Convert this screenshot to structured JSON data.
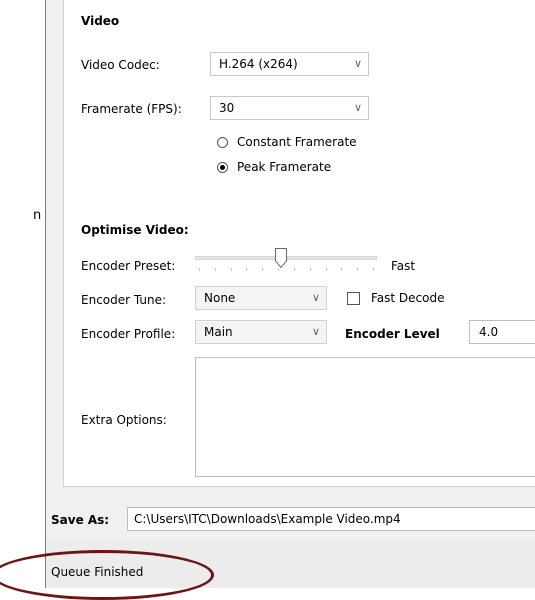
{
  "edge_fragment": "n",
  "video": {
    "section_title": "Video",
    "codec_label": "Video Codec:",
    "codec_value": "H.264 (x264)",
    "framerate_label": "Framerate (FPS):",
    "framerate_value": "30",
    "constant_label": "Constant Framerate",
    "peak_label": "Peak Framerate",
    "selected_mode": "peak"
  },
  "optimise": {
    "section_title": "Optimise Video:",
    "preset_label": "Encoder Preset:",
    "preset_value": "Fast",
    "preset_position": 0.47,
    "tune_label": "Encoder Tune:",
    "tune_value": "None",
    "fast_decode_label": "Fast Decode",
    "fast_decode_checked": false,
    "profile_label": "Encoder Profile:",
    "profile_value": "Main",
    "level_label": "Encoder Level",
    "level_value": "4.0",
    "extra_label": "Extra Options:",
    "extra_value": ""
  },
  "save": {
    "label": "Save As:",
    "path": "C:\\Users\\ITC\\Downloads\\Example Video.mp4"
  },
  "status": {
    "text": "Queue Finished",
    "highlight_color": "#6e1414"
  },
  "icons": {
    "dropdown": "chevron-down-icon",
    "slider_thumb": "slider-thumb-icon"
  }
}
